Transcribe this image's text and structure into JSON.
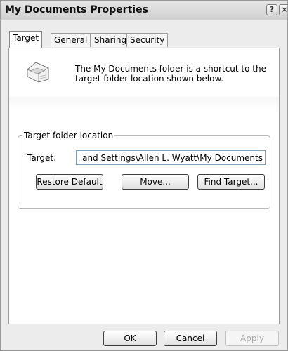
{
  "window": {
    "title": "My Documents Properties",
    "help_glyph": "?",
    "close_glyph": "×"
  },
  "tabs": [
    {
      "label": "Target",
      "active": true
    },
    {
      "label": "General",
      "active": false
    },
    {
      "label": "Sharing",
      "active": false
    },
    {
      "label": "Security",
      "active": false
    }
  ],
  "target_tab": {
    "icon": "folder-icon",
    "description": "The My Documents folder is a shortcut to the target folder location shown below.",
    "group_title": "Target folder location",
    "target_label": "Target:",
    "target_value": "C:\\Documents and Settings\\Allen L. Wyatt\\My Documents",
    "restore_default_label": "Restore Default",
    "move_label": "Move...",
    "find_target_label": "Find Target..."
  },
  "footer": {
    "ok_label": "OK",
    "cancel_label": "Cancel",
    "apply_label": "Apply",
    "apply_enabled": false
  }
}
